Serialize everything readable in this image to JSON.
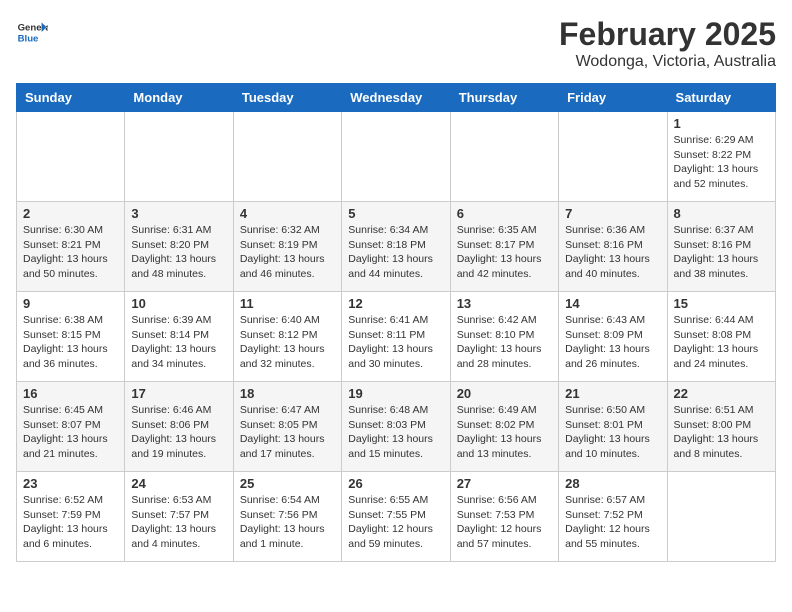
{
  "header": {
    "logo_general": "General",
    "logo_blue": "Blue",
    "title": "February 2025",
    "subtitle": "Wodonga, Victoria, Australia"
  },
  "weekdays": [
    "Sunday",
    "Monday",
    "Tuesday",
    "Wednesday",
    "Thursday",
    "Friday",
    "Saturday"
  ],
  "weeks": [
    [
      {
        "day": "",
        "info": ""
      },
      {
        "day": "",
        "info": ""
      },
      {
        "day": "",
        "info": ""
      },
      {
        "day": "",
        "info": ""
      },
      {
        "day": "",
        "info": ""
      },
      {
        "day": "",
        "info": ""
      },
      {
        "day": "1",
        "info": "Sunrise: 6:29 AM\nSunset: 8:22 PM\nDaylight: 13 hours\nand 52 minutes."
      }
    ],
    [
      {
        "day": "2",
        "info": "Sunrise: 6:30 AM\nSunset: 8:21 PM\nDaylight: 13 hours\nand 50 minutes."
      },
      {
        "day": "3",
        "info": "Sunrise: 6:31 AM\nSunset: 8:20 PM\nDaylight: 13 hours\nand 48 minutes."
      },
      {
        "day": "4",
        "info": "Sunrise: 6:32 AM\nSunset: 8:19 PM\nDaylight: 13 hours\nand 46 minutes."
      },
      {
        "day": "5",
        "info": "Sunrise: 6:34 AM\nSunset: 8:18 PM\nDaylight: 13 hours\nand 44 minutes."
      },
      {
        "day": "6",
        "info": "Sunrise: 6:35 AM\nSunset: 8:17 PM\nDaylight: 13 hours\nand 42 minutes."
      },
      {
        "day": "7",
        "info": "Sunrise: 6:36 AM\nSunset: 8:16 PM\nDaylight: 13 hours\nand 40 minutes."
      },
      {
        "day": "8",
        "info": "Sunrise: 6:37 AM\nSunset: 8:16 PM\nDaylight: 13 hours\nand 38 minutes."
      }
    ],
    [
      {
        "day": "9",
        "info": "Sunrise: 6:38 AM\nSunset: 8:15 PM\nDaylight: 13 hours\nand 36 minutes."
      },
      {
        "day": "10",
        "info": "Sunrise: 6:39 AM\nSunset: 8:14 PM\nDaylight: 13 hours\nand 34 minutes."
      },
      {
        "day": "11",
        "info": "Sunrise: 6:40 AM\nSunset: 8:12 PM\nDaylight: 13 hours\nand 32 minutes."
      },
      {
        "day": "12",
        "info": "Sunrise: 6:41 AM\nSunset: 8:11 PM\nDaylight: 13 hours\nand 30 minutes."
      },
      {
        "day": "13",
        "info": "Sunrise: 6:42 AM\nSunset: 8:10 PM\nDaylight: 13 hours\nand 28 minutes."
      },
      {
        "day": "14",
        "info": "Sunrise: 6:43 AM\nSunset: 8:09 PM\nDaylight: 13 hours\nand 26 minutes."
      },
      {
        "day": "15",
        "info": "Sunrise: 6:44 AM\nSunset: 8:08 PM\nDaylight: 13 hours\nand 24 minutes."
      }
    ],
    [
      {
        "day": "16",
        "info": "Sunrise: 6:45 AM\nSunset: 8:07 PM\nDaylight: 13 hours\nand 21 minutes."
      },
      {
        "day": "17",
        "info": "Sunrise: 6:46 AM\nSunset: 8:06 PM\nDaylight: 13 hours\nand 19 minutes."
      },
      {
        "day": "18",
        "info": "Sunrise: 6:47 AM\nSunset: 8:05 PM\nDaylight: 13 hours\nand 17 minutes."
      },
      {
        "day": "19",
        "info": "Sunrise: 6:48 AM\nSunset: 8:03 PM\nDaylight: 13 hours\nand 15 minutes."
      },
      {
        "day": "20",
        "info": "Sunrise: 6:49 AM\nSunset: 8:02 PM\nDaylight: 13 hours\nand 13 minutes."
      },
      {
        "day": "21",
        "info": "Sunrise: 6:50 AM\nSunset: 8:01 PM\nDaylight: 13 hours\nand 10 minutes."
      },
      {
        "day": "22",
        "info": "Sunrise: 6:51 AM\nSunset: 8:00 PM\nDaylight: 13 hours\nand 8 minutes."
      }
    ],
    [
      {
        "day": "23",
        "info": "Sunrise: 6:52 AM\nSunset: 7:59 PM\nDaylight: 13 hours\nand 6 minutes."
      },
      {
        "day": "24",
        "info": "Sunrise: 6:53 AM\nSunset: 7:57 PM\nDaylight: 13 hours\nand 4 minutes."
      },
      {
        "day": "25",
        "info": "Sunrise: 6:54 AM\nSunset: 7:56 PM\nDaylight: 13 hours\nand 1 minute."
      },
      {
        "day": "26",
        "info": "Sunrise: 6:55 AM\nSunset: 7:55 PM\nDaylight: 12 hours\nand 59 minutes."
      },
      {
        "day": "27",
        "info": "Sunrise: 6:56 AM\nSunset: 7:53 PM\nDaylight: 12 hours\nand 57 minutes."
      },
      {
        "day": "28",
        "info": "Sunrise: 6:57 AM\nSunset: 7:52 PM\nDaylight: 12 hours\nand 55 minutes."
      },
      {
        "day": "",
        "info": ""
      }
    ]
  ]
}
